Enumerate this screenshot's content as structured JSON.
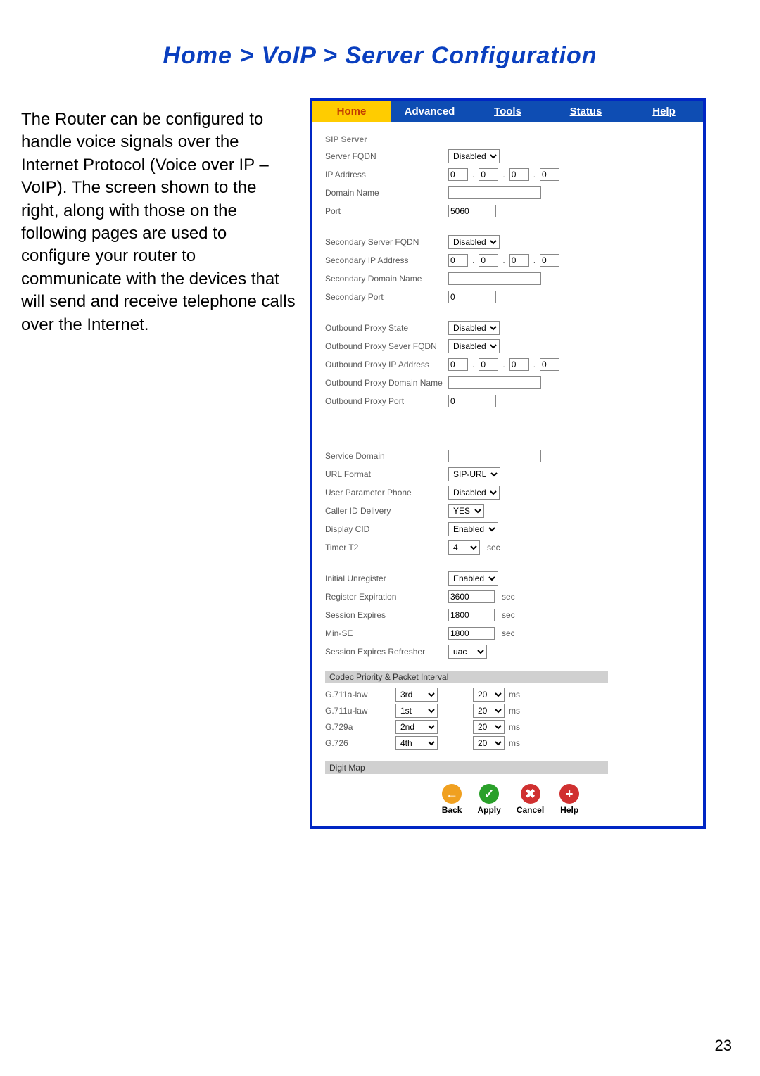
{
  "page_title": "Home > VoIP > Server Configuration",
  "description": "The Router can be configured to handle voice signals over the Internet Protocol (Voice over IP – VoIP).   The screen shown to the right, along with those on the following pages are used to configure your router to communicate with the devices that will send and receive telephone calls over the Internet.",
  "page_number": "23",
  "tabs": {
    "home": "Home",
    "advanced": "Advanced",
    "tools": "Tools",
    "status": "Status",
    "help": "Help"
  },
  "sip": {
    "section": "SIP Server",
    "server_fqdn_label": "Server FQDN",
    "server_fqdn_value": "Disabled",
    "ip_label": "IP Address",
    "ip": [
      "0",
      "0",
      "0",
      "0"
    ],
    "domain_label": "Domain Name",
    "domain_value": "",
    "port_label": "Port",
    "port_value": "5060",
    "sec_fqdn_label": "Secondary Server FQDN",
    "sec_fqdn_value": "Disabled",
    "sec_ip_label": "Secondary IP Address",
    "sec_ip": [
      "0",
      "0",
      "0",
      "0"
    ],
    "sec_domain_label": "Secondary Domain Name",
    "sec_domain_value": "",
    "sec_port_label": "Secondary Port",
    "sec_port_value": "0",
    "ob_state_label": "Outbound Proxy State",
    "ob_state_value": "Disabled",
    "ob_fqdn_label": "Outbound Proxy Sever FQDN",
    "ob_fqdn_value": "Disabled",
    "ob_ip_label": "Outbound Proxy IP Address",
    "ob_ip": [
      "0",
      "0",
      "0",
      "0"
    ],
    "ob_domain_label": "Outbound Proxy Domain Name",
    "ob_domain_value": "",
    "ob_port_label": "Outbound Proxy Port",
    "ob_port_value": "0"
  },
  "svc": {
    "service_domain_label": "Service Domain",
    "service_domain_value": "",
    "url_format_label": "URL Format",
    "url_format_value": "SIP-URL",
    "user_param_label": "User Parameter Phone",
    "user_param_value": "Disabled",
    "cid_delivery_label": "Caller ID Delivery",
    "cid_delivery_value": "YES",
    "display_cid_label": "Display CID",
    "display_cid_value": "Enabled",
    "timer_t2_label": "Timer T2",
    "timer_t2_value": "4",
    "timer_t2_unit": "sec",
    "init_unreg_label": "Initial Unregister",
    "init_unreg_value": "Enabled",
    "reg_exp_label": "Register Expiration",
    "reg_exp_value": "3600",
    "reg_exp_unit": "sec",
    "sess_exp_label": "Session Expires",
    "sess_exp_value": "1800",
    "sess_exp_unit": "sec",
    "minse_label": "Min-SE",
    "minse_value": "1800",
    "minse_unit": "sec",
    "refresher_label": "Session Expires Refresher",
    "refresher_value": "uac"
  },
  "codec": {
    "header": "Codec Priority & Packet Interval",
    "unit": "ms",
    "rows": [
      {
        "name": "G.711a-law",
        "prio": "3rd",
        "intv": "20"
      },
      {
        "name": "G.711u-law",
        "prio": "1st",
        "intv": "20"
      },
      {
        "name": "G.729a",
        "prio": "2nd",
        "intv": "20"
      },
      {
        "name": "G.726",
        "prio": "4th",
        "intv": "20"
      }
    ]
  },
  "digit_map_header": "Digit Map",
  "buttons": {
    "back": "Back",
    "apply": "Apply",
    "cancel": "Cancel",
    "help": "Help"
  }
}
